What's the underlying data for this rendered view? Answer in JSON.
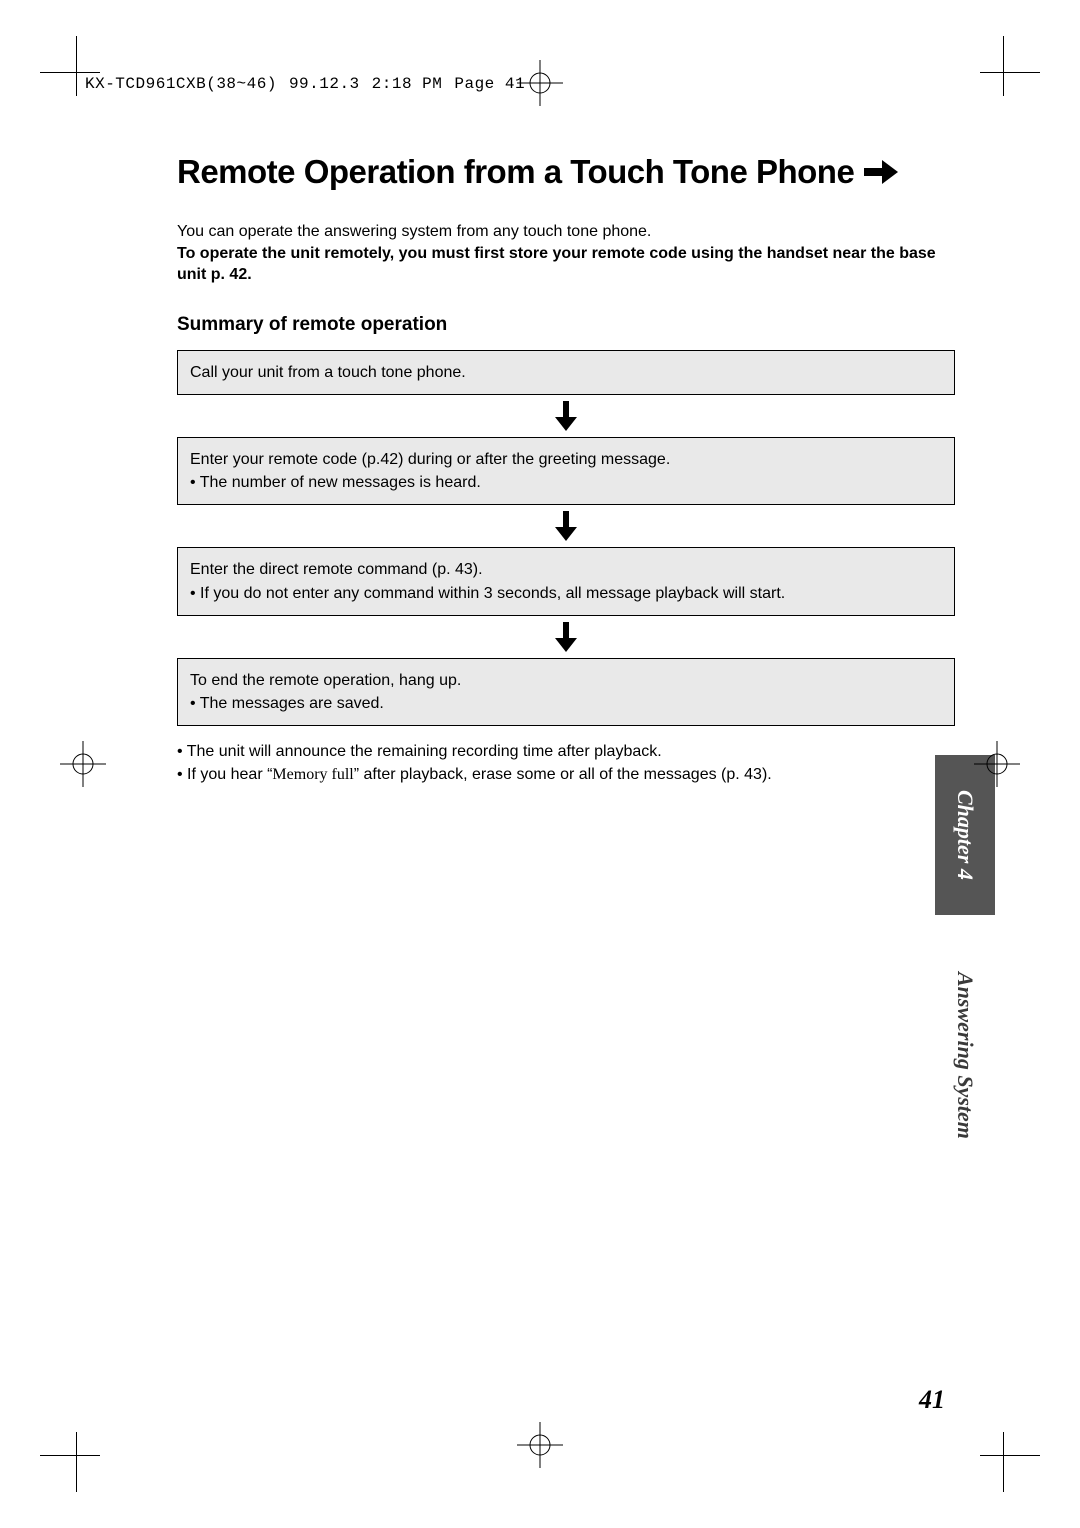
{
  "slug": {
    "file": "KX-TCD961CXB(38~46)",
    "date": "99.12.3",
    "time": "2:18 PM",
    "page_label": "Page 41"
  },
  "title": "Remote Operation from a Touch Tone Phone",
  "intro": {
    "line1": "You can operate the answering system from any touch tone phone.",
    "bold": "To operate the unit remotely, you must first store your remote code using the handset near the base unit p. 42."
  },
  "subhead": "Summary of remote operation",
  "steps": {
    "s1": "Call your unit from a touch tone phone.",
    "s2": {
      "l1": "Enter your remote code (p.42) during or after the greeting message.",
      "l2": "• The number of new messages is heard."
    },
    "s3": {
      "l1": "Enter the direct remote command (p. 43).",
      "l2": "• If you do not enter any command within 3 seconds, all message playback will start."
    },
    "s4": {
      "l1": "To end the remote operation, hang up.",
      "l2": "• The messages are saved."
    }
  },
  "notes": {
    "n1": "• The unit will announce the remaining recording time after playback.",
    "n2_pre": "• If you hear “",
    "n2_quote": "Memory full",
    "n2_post": "” after playback, erase some or all of the messages (p. 43)."
  },
  "tab": {
    "top": "Chapter 4",
    "bottom": "Answering System"
  },
  "pagenum": "41"
}
